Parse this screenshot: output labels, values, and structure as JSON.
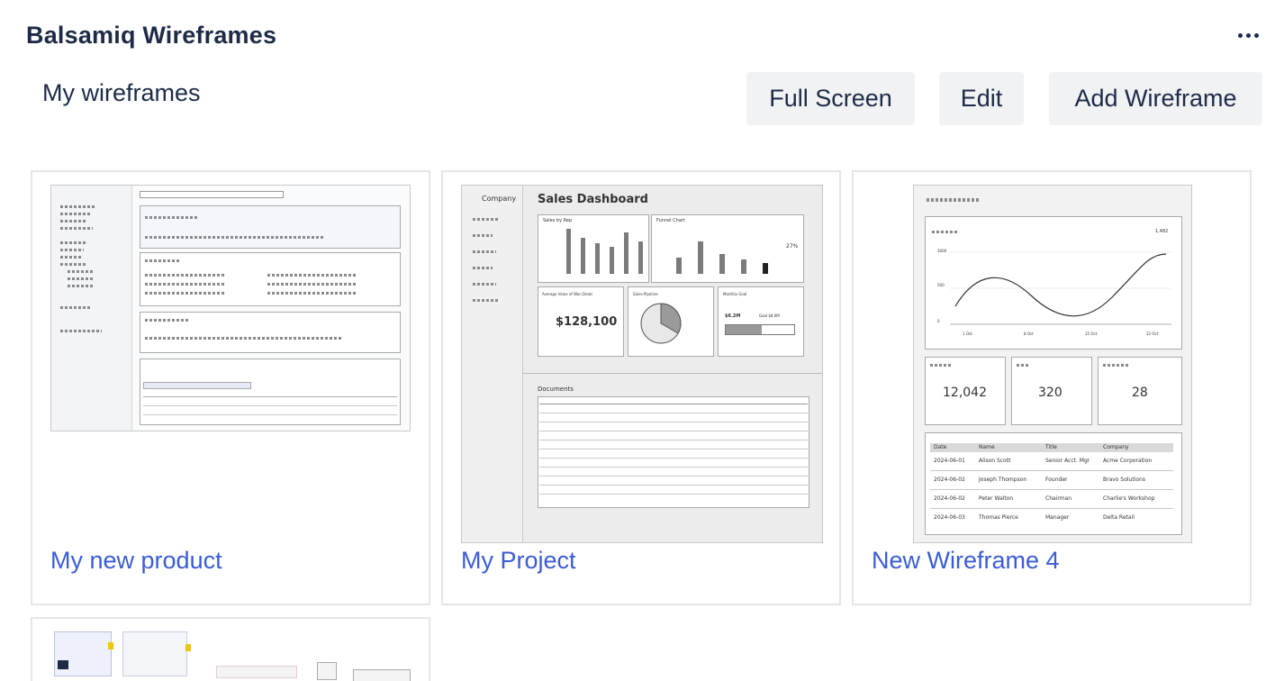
{
  "header": {
    "title": "Balsamiq Wireframes",
    "more_icon": "more-horizontal-icon"
  },
  "section": {
    "title": "My wireframes"
  },
  "toolbar": {
    "full_screen_label": "Full Screen",
    "edit_label": "Edit",
    "add_label": "Add Wireframe"
  },
  "cards": [
    {
      "title": "My new product"
    },
    {
      "title": "My Project",
      "thumb": {
        "company": "Company",
        "dashboard_title": "Sales Dashboard",
        "panel_1": "Sales by Rep",
        "panel_2": "Funnel Chart",
        "panel_2_value": "27%",
        "panel_3": "Average Value of Won Deals",
        "panel_3_value": "$128,100",
        "panel_4": "Sales Pipeline",
        "panel_5": "Monthly Goal",
        "panel_5_value": "$6.2M",
        "panel_5_goal": "Goal $8.0M",
        "documents_title": "Documents"
      }
    },
    {
      "title": "New Wireframe 4",
      "thumb": {
        "chart_value": "1,482",
        "y_ticks": [
          "3000",
          "500",
          "0"
        ],
        "x_ticks": [
          "1 Oct",
          "8 Oct",
          "15 Oct",
          "22 Oct"
        ],
        "stats": [
          "12,042",
          "320",
          "28"
        ],
        "table_headers": [
          "Date",
          "Name",
          "Title",
          "Company"
        ],
        "table_rows": [
          [
            "2024-06-01",
            "Alison Scott",
            "Senior Acct. Mgr",
            "Acme Corporation"
          ],
          [
            "2024-06-02",
            "Joseph Thompson",
            "Founder",
            "Bravo Solutions"
          ],
          [
            "2024-06-02",
            "Peter Walton",
            "Chairman",
            "Charlie's Workshop"
          ],
          [
            "2024-06-03",
            "Thomas Pierce",
            "Manager",
            "Delta Retail"
          ]
        ]
      }
    }
  ]
}
